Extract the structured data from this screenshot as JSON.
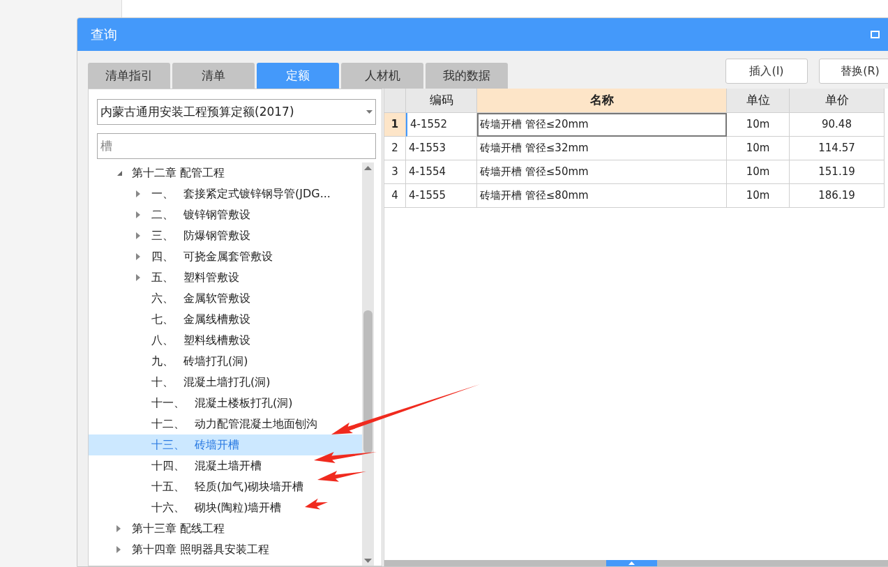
{
  "window": {
    "title": "查询"
  },
  "tabs": [
    {
      "label": "清单指引",
      "selected": false
    },
    {
      "label": "清单",
      "selected": false
    },
    {
      "label": "定额",
      "selected": true
    },
    {
      "label": "人材机",
      "selected": false
    },
    {
      "label": "我的数据",
      "selected": false
    }
  ],
  "buttons": [
    "插入(I)",
    "替换(R)"
  ],
  "library_select": {
    "value": "内蒙古通用安装工程预算定额(2017)"
  },
  "search": {
    "value": "槽"
  },
  "tree": [
    {
      "kind": "group",
      "expanded": true,
      "selected": false,
      "title": "第十二章 配管工程",
      "children": [
        {
          "kind": "group",
          "expanded": false,
          "selected": false,
          "number": "一、",
          "title": "套接紧定式镀锌钢导管(JDG..."
        },
        {
          "kind": "group",
          "expanded": false,
          "selected": false,
          "number": "二、",
          "title": "镀锌钢管敷设"
        },
        {
          "kind": "group",
          "expanded": false,
          "selected": false,
          "number": "三、",
          "title": "防爆钢管敷设"
        },
        {
          "kind": "group",
          "expanded": false,
          "selected": false,
          "number": "四、",
          "title": "可挠金属套管敷设"
        },
        {
          "kind": "group",
          "expanded": false,
          "selected": false,
          "number": "五、",
          "title": "塑料管敷设"
        },
        {
          "kind": "leaf",
          "selected": false,
          "number": "六、",
          "title": "金属软管敷设"
        },
        {
          "kind": "leaf",
          "selected": false,
          "number": "七、",
          "title": "金属线槽敷设"
        },
        {
          "kind": "leaf",
          "selected": false,
          "number": "八、",
          "title": "塑料线槽敷设"
        },
        {
          "kind": "leaf",
          "selected": false,
          "number": "九、",
          "title": "砖墙打孔(洞)"
        },
        {
          "kind": "leaf",
          "selected": false,
          "number": "十、",
          "title": "混凝土墙打孔(洞)"
        },
        {
          "kind": "leaf",
          "selected": false,
          "number": "十一、",
          "title": "混凝土楼板打孔(洞)"
        },
        {
          "kind": "leaf",
          "selected": false,
          "number": "十二、",
          "title": "动力配管混凝土地面刨沟"
        },
        {
          "kind": "leaf",
          "selected": true,
          "number": "十三、",
          "title": "砖墙开槽"
        },
        {
          "kind": "leaf",
          "selected": false,
          "number": "十四、",
          "title": "混凝土墙开槽"
        },
        {
          "kind": "leaf",
          "selected": false,
          "number": "十五、",
          "title": "轻质(加气)砌块墙开槽"
        },
        {
          "kind": "leaf",
          "selected": false,
          "number": "十六、",
          "title": "砌块(陶粒)墙开槽"
        }
      ]
    },
    {
      "kind": "group",
      "expanded": false,
      "selected": false,
      "title": "第十三章 配线工程"
    },
    {
      "kind": "group",
      "expanded": false,
      "selected": false,
      "title": "第十四章 照明器具安装工程"
    }
  ],
  "table": {
    "columns": [
      {
        "label": "编码",
        "selected": false
      },
      {
        "label": "名称",
        "selected": true
      },
      {
        "label": "单位",
        "selected": false
      },
      {
        "label": "单价",
        "selected": false
      }
    ],
    "rows": [
      {
        "index": "1",
        "selected": true,
        "cells": [
          "4-1552",
          "砖墙开槽 管径≤20mm",
          "10m",
          "90.48"
        ]
      },
      {
        "index": "2",
        "selected": false,
        "cells": [
          "4-1553",
          "砖墙开槽 管径≤32mm",
          "10m",
          "114.57"
        ]
      },
      {
        "index": "3",
        "selected": false,
        "cells": [
          "4-1554",
          "砖墙开槽 管径≤50mm",
          "10m",
          "151.19"
        ]
      },
      {
        "index": "4",
        "selected": false,
        "cells": [
          "4-1555",
          "砖墙开槽 管径≤80mm",
          "10m",
          "186.19"
        ]
      }
    ]
  }
}
